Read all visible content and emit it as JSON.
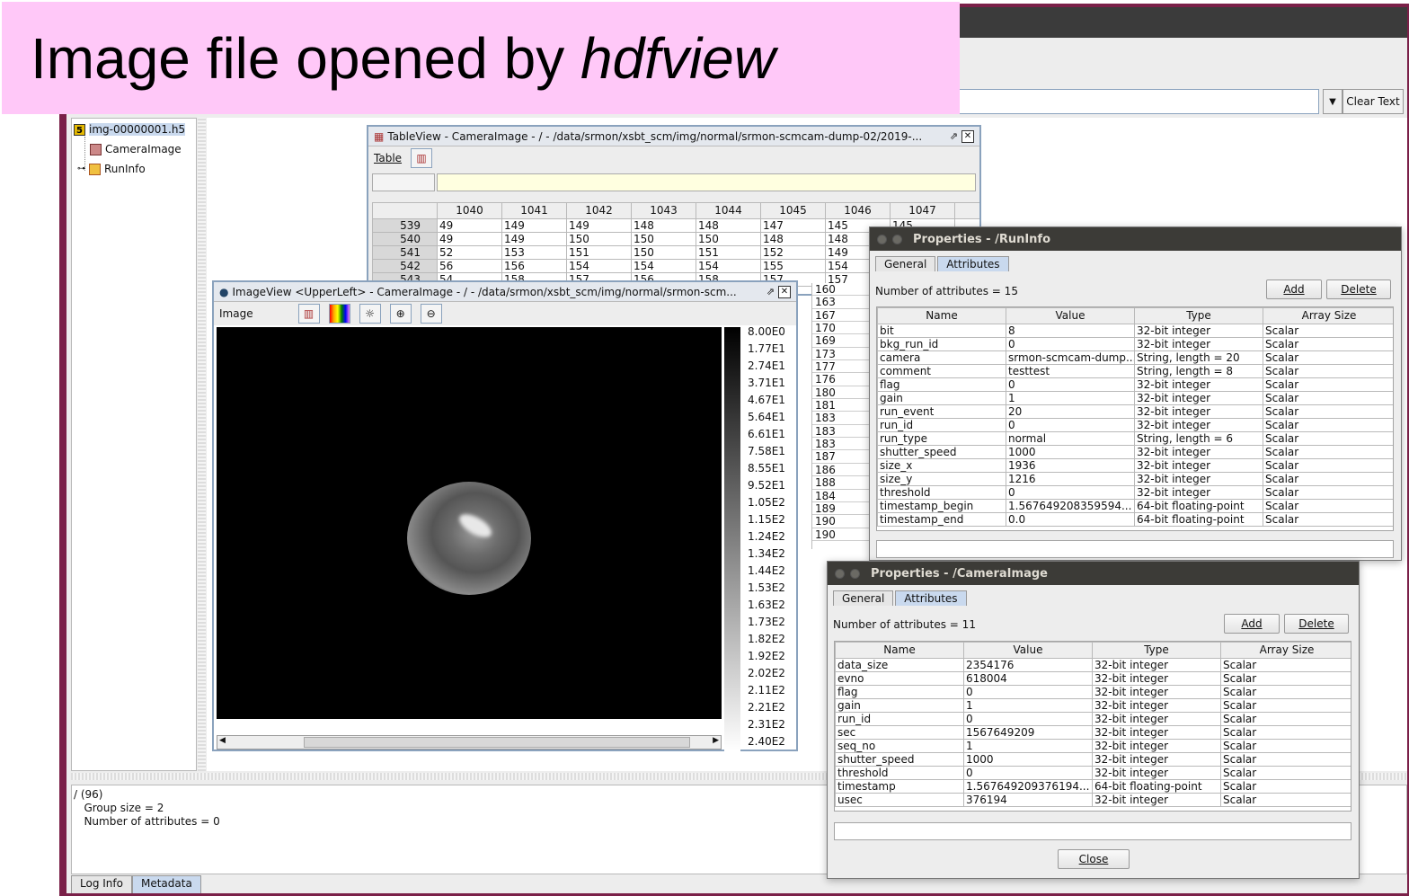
{
  "banner": {
    "text_prefix": "Image file opened by ",
    "text_italic": "hdfview"
  },
  "toolbar": {
    "clear_text": "Clear Text"
  },
  "tree": {
    "file": "img-00000001.h5",
    "items": [
      "CameraImage",
      "RunInfo"
    ]
  },
  "info_pane": {
    "lines": [
      "/ (96)",
      "   Group size = 2",
      "   Number of attributes = 0"
    ]
  },
  "bottom_tabs": [
    "Log Info",
    "Metadata"
  ],
  "table_view": {
    "title": "TableView  -  CameraImage  -  /  -  /data/srmon/xsbt_scm/img/normal/srmon-scmcam-dump-02/2019-...",
    "menu": "Table",
    "columns": [
      "1040",
      "1041",
      "1042",
      "1043",
      "1044",
      "1045",
      "1046",
      "1047"
    ],
    "rows": [
      {
        "id": "539",
        "values": [
          "49",
          "149",
          "149",
          "148",
          "148",
          "147",
          "145",
          "145"
        ]
      },
      {
        "id": "540",
        "values": [
          "49",
          "149",
          "150",
          "150",
          "150",
          "148",
          "148",
          ""
        ]
      },
      {
        "id": "541",
        "values": [
          "52",
          "153",
          "151",
          "150",
          "151",
          "152",
          "149",
          ""
        ]
      },
      {
        "id": "542",
        "values": [
          "56",
          "156",
          "154",
          "154",
          "154",
          "155",
          "154",
          ""
        ]
      },
      {
        "id": "543",
        "values": [
          "54",
          "158",
          "157",
          "156",
          "158",
          "157",
          "157",
          ""
        ]
      }
    ],
    "visible_col_1046": [
      "160",
      "163",
      "167",
      "170",
      "169",
      "173",
      "177",
      "176",
      "180",
      "181",
      "183",
      "183",
      "183",
      "187",
      "186",
      "188",
      "184",
      "189",
      "190",
      "190"
    ]
  },
  "image_view": {
    "title": "ImageView <UpperLeft>  -  CameraImage  -  /  -  /data/srmon/xsbt_scm/img/normal/srmon-scm...",
    "menu": "Image",
    "colorbar_labels": [
      "8.00E0",
      "1.77E1",
      "2.74E1",
      "3.71E1",
      "4.67E1",
      "5.64E1",
      "6.61E1",
      "7.58E1",
      "8.55E1",
      "9.52E1",
      "1.05E2",
      "1.15E2",
      "1.24E2",
      "1.34E2",
      "1.44E2",
      "1.53E2",
      "1.63E2",
      "1.73E2",
      "1.82E2",
      "1.92E2",
      "2.02E2",
      "2.11E2",
      "2.21E2",
      "2.31E2",
      "2.40E2"
    ]
  },
  "runinfo": {
    "title": "Properties - /RunInfo",
    "tabs": [
      "General",
      "Attributes"
    ],
    "count_label": "Number of attributes = 15",
    "add": "Add",
    "delete": "Delete",
    "headers": [
      "Name",
      "Value",
      "Type",
      "Array Size"
    ],
    "rows": [
      [
        "bit",
        "8",
        "32-bit integer",
        "Scalar"
      ],
      [
        "bkg_run_id",
        "0",
        "32-bit integer",
        "Scalar"
      ],
      [
        "camera",
        "srmon-scmcam-dump...",
        "String, length = 20",
        "Scalar"
      ],
      [
        "comment",
        "testtest",
        "String, length = 8",
        "Scalar"
      ],
      [
        "flag",
        "0",
        "32-bit integer",
        "Scalar"
      ],
      [
        "gain",
        "1",
        "32-bit integer",
        "Scalar"
      ],
      [
        "run_event",
        "20",
        "32-bit integer",
        "Scalar"
      ],
      [
        "run_id",
        "0",
        "32-bit integer",
        "Scalar"
      ],
      [
        "run_type",
        "normal",
        "String, length = 6",
        "Scalar"
      ],
      [
        "shutter_speed",
        "1000",
        "32-bit integer",
        "Scalar"
      ],
      [
        "size_x",
        "1936",
        "32-bit integer",
        "Scalar"
      ],
      [
        "size_y",
        "1216",
        "32-bit integer",
        "Scalar"
      ],
      [
        "threshold",
        "0",
        "32-bit integer",
        "Scalar"
      ],
      [
        "timestamp_begin",
        "1.567649208359594...",
        "64-bit floating-point",
        "Scalar"
      ],
      [
        "timestamp_end",
        "0.0",
        "64-bit floating-point",
        "Scalar"
      ]
    ]
  },
  "cameraimage": {
    "title": "Properties - /CameraImage",
    "tabs": [
      "General",
      "Attributes"
    ],
    "count_label": "Number of attributes = 11",
    "add": "Add",
    "delete": "Delete",
    "close": "Close",
    "headers": [
      "Name",
      "Value",
      "Type",
      "Array Size"
    ],
    "rows": [
      [
        "data_size",
        "2354176",
        "32-bit integer",
        "Scalar"
      ],
      [
        "evno",
        "618004",
        "32-bit integer",
        "Scalar"
      ],
      [
        "flag",
        "0",
        "32-bit integer",
        "Scalar"
      ],
      [
        "gain",
        "1",
        "32-bit integer",
        "Scalar"
      ],
      [
        "run_id",
        "0",
        "32-bit integer",
        "Scalar"
      ],
      [
        "sec",
        "1567649209",
        "32-bit integer",
        "Scalar"
      ],
      [
        "seq_no",
        "1",
        "32-bit integer",
        "Scalar"
      ],
      [
        "shutter_speed",
        "1000",
        "32-bit integer",
        "Scalar"
      ],
      [
        "threshold",
        "0",
        "32-bit integer",
        "Scalar"
      ],
      [
        "timestamp",
        "1.567649209376194...",
        "64-bit floating-point",
        "Scalar"
      ],
      [
        "usec",
        "376194",
        "32-bit integer",
        "Scalar"
      ]
    ]
  }
}
